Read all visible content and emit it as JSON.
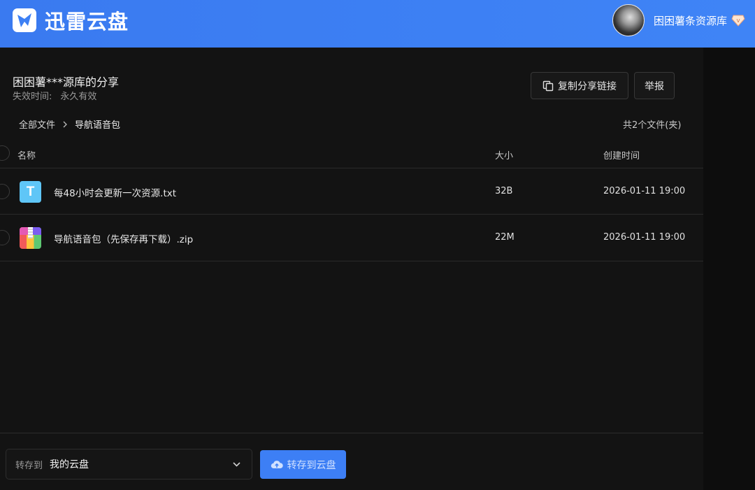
{
  "header": {
    "app_name": "迅雷云盘",
    "username": "困困薯条资源库",
    "brand_color": "#3d80f4"
  },
  "share": {
    "title": "困困薯***源库的分享",
    "expire_label": "失效时间:",
    "expire_value": "永久有效",
    "copy_link_label": "复制分享链接",
    "report_label": "举报"
  },
  "breadcrumb": {
    "root": "全部文件",
    "current": "导航语音包"
  },
  "file_count": "共2个文件(夹)",
  "table": {
    "headers": {
      "name": "名称",
      "size": "大小",
      "created": "创建时间"
    },
    "rows": [
      {
        "icon": "txt-file-icon",
        "icon_glyph": "T",
        "name": "每48小时会更新一次资源.txt",
        "size": "32B",
        "created": "2026-01-11 19:00"
      },
      {
        "icon": "zip-file-icon",
        "name": "导航语音包（先保存再下载）.zip",
        "size": "22M",
        "created": "2026-01-11 19:00"
      }
    ]
  },
  "footer": {
    "save_to_label": "转存到",
    "save_to_value": "我的云盘",
    "save_button": "转存到云盘"
  }
}
